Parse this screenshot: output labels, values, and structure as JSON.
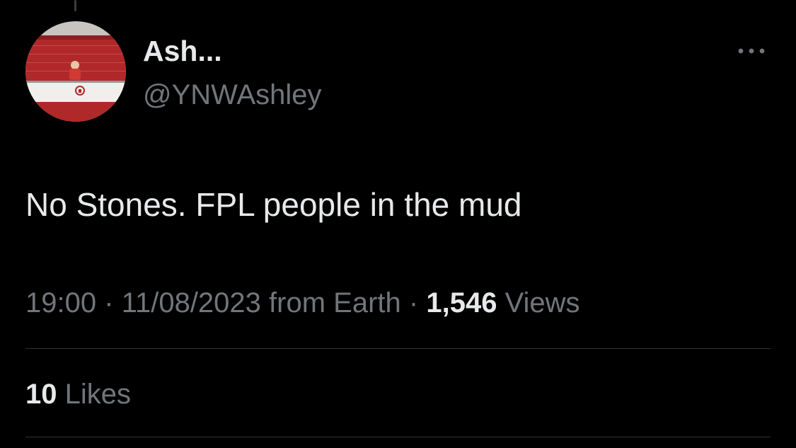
{
  "user": {
    "display_name": "Ash...",
    "handle": "@YNWAshley",
    "avatar_icon": "press-conference-avatar"
  },
  "menu": {
    "icon": "more-horizontal-icon"
  },
  "tweet": {
    "text": "No Stones. FPL people in the mud"
  },
  "meta": {
    "time": "19:00",
    "separator": "·",
    "date": "11/08/2023",
    "source": "from Earth",
    "views_count": "1,546",
    "views_label": "Views"
  },
  "stats": {
    "likes_count": "10",
    "likes_label": "Likes"
  },
  "colors": {
    "background": "#000000",
    "primary_text": "#e7e9ea",
    "secondary_text": "#71767b",
    "divider": "#2f3336"
  }
}
